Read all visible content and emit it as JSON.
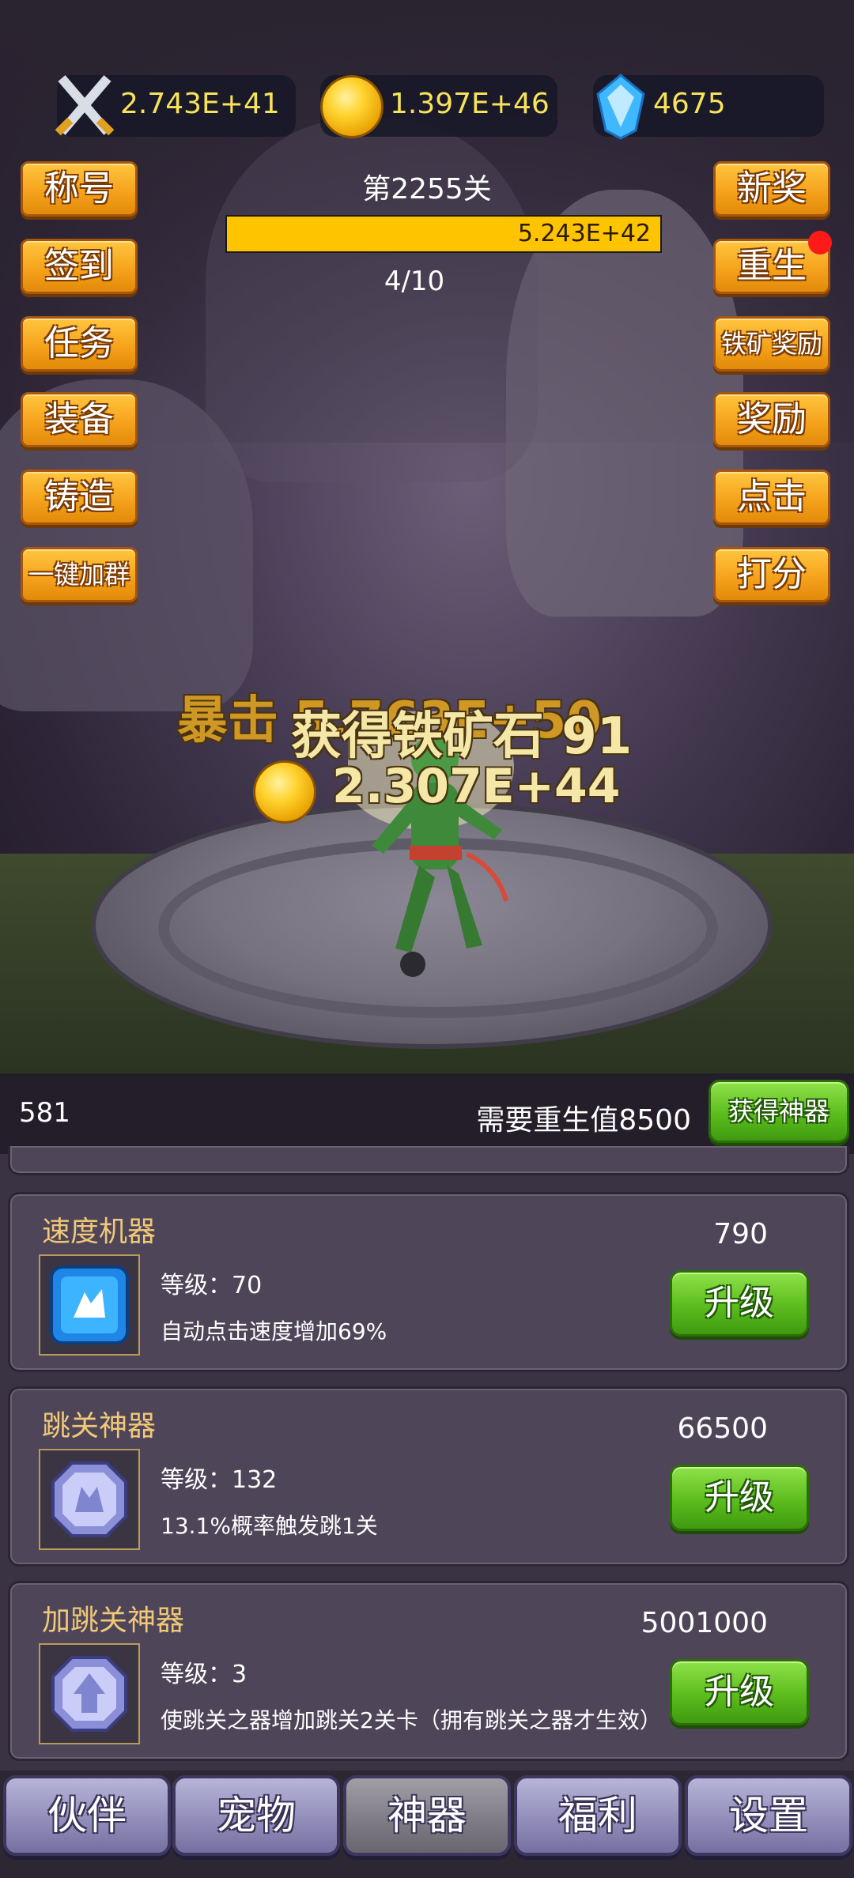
{
  "resources": {
    "attack": {
      "icon": "crossed-swords-icon",
      "value": "2.743E+41"
    },
    "gold": {
      "icon": "gold-coin-icon",
      "value": "1.397E+46"
    },
    "gems": {
      "icon": "blue-gem-icon",
      "value": "4675"
    }
  },
  "left_menu": [
    "称号",
    "签到",
    "任务",
    "装备",
    "铸造",
    "一键加群"
  ],
  "right_menu": [
    "新奖",
    "重生",
    "铁矿奖励",
    "奖励",
    "点击",
    "打分"
  ],
  "stage": {
    "title": "第2255关",
    "hp_value": "5.243E+42",
    "hp_fraction": 1.0,
    "wave": "4/10"
  },
  "floating": {
    "crit": "暴击",
    "crit_value": "5.763E+50",
    "ore": "获得铁矿石 91",
    "gold_gain": "2.307E+44"
  },
  "info": {
    "count": "581",
    "rebirth_req": "需要重生值8500",
    "get_artifact": "获得神器"
  },
  "artifacts": [
    {
      "name": "速度机器",
      "cost": "790",
      "level": "等级：70",
      "desc": "自动点击速度增加69%",
      "upgrade": "升级"
    },
    {
      "name": "跳关神器",
      "cost": "66500",
      "level": "等级：132",
      "desc": "13.1%概率触发跳1关",
      "upgrade": "升级"
    },
    {
      "name": "加跳关神器",
      "cost": "5001000",
      "level": "等级：3",
      "desc": "使跳关之器增加跳关2关卡（拥有跳关之器才生效）",
      "upgrade": "升级"
    }
  ],
  "tabs": [
    "伙伴",
    "宠物",
    "神器",
    "福利",
    "设置"
  ],
  "active_tab": "神器",
  "colors": {
    "accent_gold": "#ffc400",
    "button_orange": "#f6a31c",
    "button_green": "#5cbc1d",
    "notify_red": "#ff1a1a"
  }
}
